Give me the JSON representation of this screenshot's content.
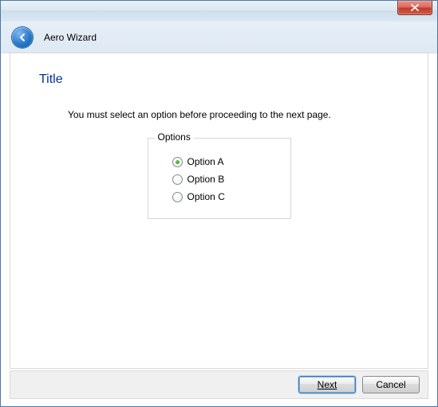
{
  "window": {
    "wizard_name": "Aero Wizard"
  },
  "page": {
    "title": "Title",
    "instruction": "You must select an option before proceeding to the next page."
  },
  "options": {
    "group_label": "Options",
    "items": [
      {
        "label": "Option A",
        "checked": true
      },
      {
        "label": "Option B",
        "checked": false
      },
      {
        "label": "Option C",
        "checked": false
      }
    ]
  },
  "footer": {
    "next_label": "Next",
    "cancel_label": "Cancel"
  },
  "icons": {
    "back": "back-arrow-icon",
    "close": "close-icon"
  }
}
